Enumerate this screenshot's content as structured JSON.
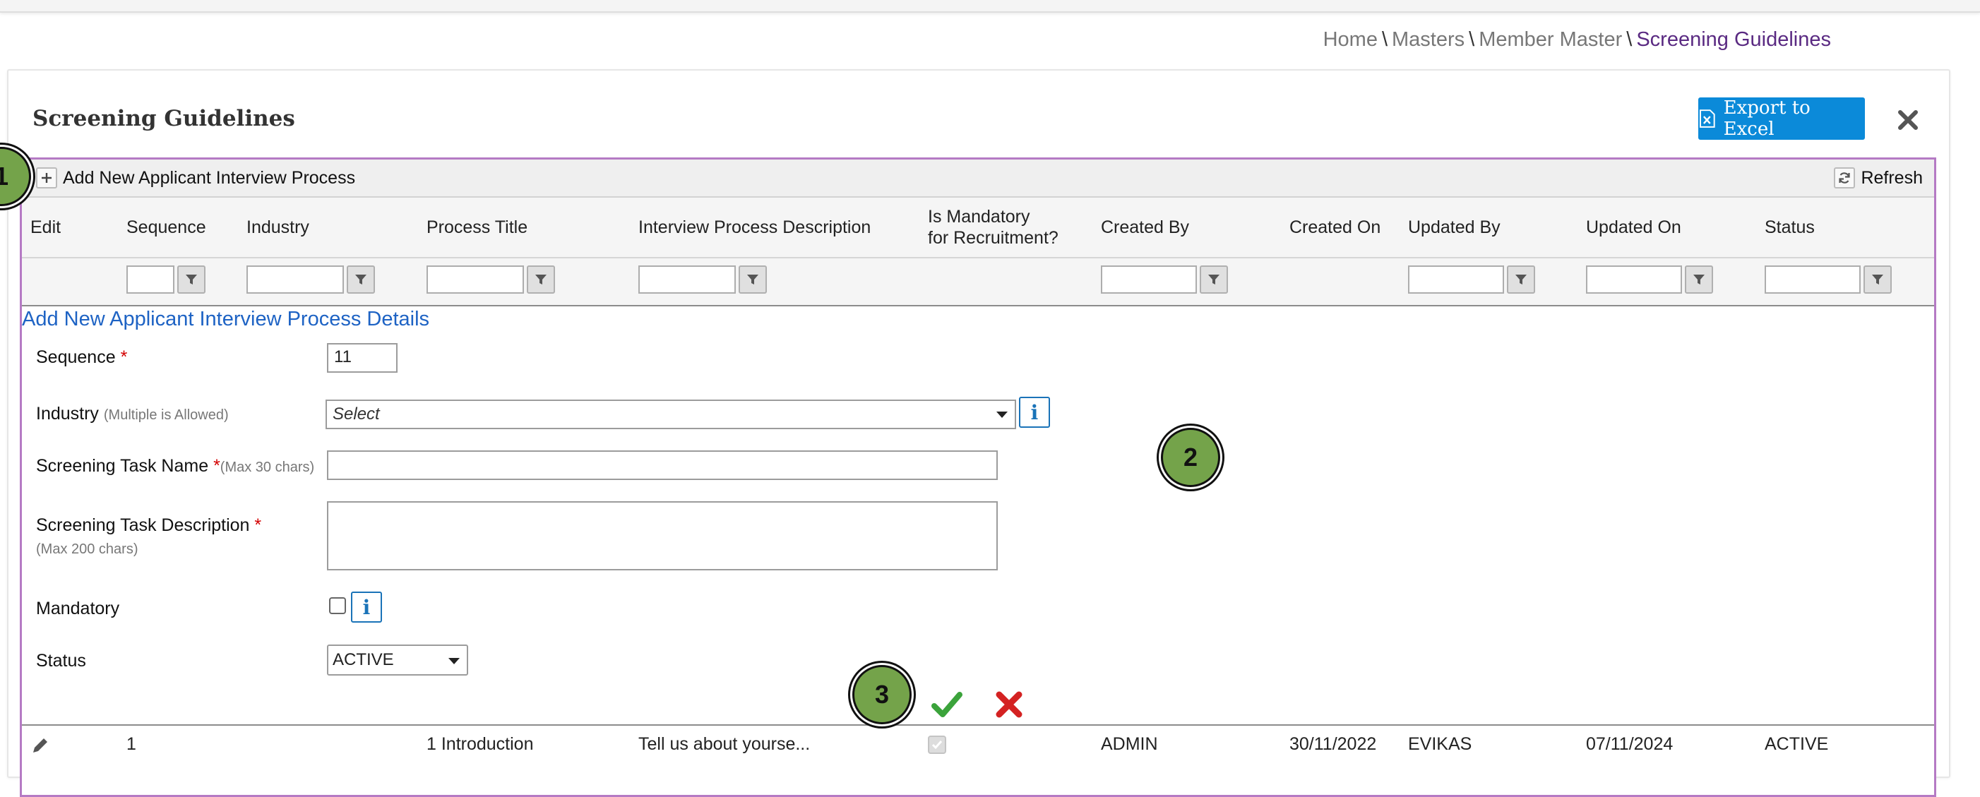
{
  "breadcrumb": {
    "home": "Home",
    "masters": "Masters",
    "member_master": "Member Master",
    "current": "Screening Guidelines",
    "separator": "\\"
  },
  "page": {
    "title": "Screening Guidelines",
    "export_label": "Export to Excel"
  },
  "toolbar": {
    "add_label": "Add New Applicant Interview Process",
    "refresh_label": "Refresh"
  },
  "columns": {
    "edit": "Edit",
    "sequence": "Sequence",
    "industry": "Industry",
    "process_title": "Process Title",
    "description": "Interview Process Description",
    "mandatory_line1": "Is Mandatory",
    "mandatory_line2": "for Recruitment?",
    "created_by": "Created By",
    "created_on": "Created On",
    "updated_by": "Updated By",
    "updated_on": "Updated On",
    "status": "Status"
  },
  "form": {
    "title": "Add New Applicant Interview Process Details",
    "sequence_label": "Sequence",
    "sequence_value": "11",
    "industry_label": "Industry",
    "industry_hint": "(Multiple is Allowed)",
    "industry_placeholder": "Select",
    "task_name_label": "Screening Task Name",
    "task_name_hint": "(Max 30 chars)",
    "task_desc_label": "Screening Task Description",
    "task_desc_hint": "(Max 200 chars)",
    "mandatory_label": "Mandatory",
    "status_label": "Status",
    "status_value": "ACTIVE",
    "required_mark": "*"
  },
  "markers": [
    "1",
    "2",
    "3"
  ],
  "rows": [
    {
      "sequence": "1",
      "industry": "",
      "process_title": "1 Introduction",
      "description": "Tell us about yourse...",
      "created_by": "ADMIN",
      "created_on": "30/11/2022",
      "updated_by": "EVIKAS",
      "updated_on": "07/11/2024",
      "status": "ACTIVE"
    }
  ],
  "icons": {
    "export": "excel-file-icon",
    "close": "close-icon",
    "add": "plus-icon",
    "refresh": "refresh-icon",
    "filter": "filter-funnel-icon",
    "info": "info-icon",
    "save": "checkmark-icon",
    "cancel": "x-mark-icon",
    "edit": "pencil-icon"
  },
  "colors": {
    "accent": "#0b8ad9",
    "breadcrumb_current": "#5a2a82",
    "form_title": "#1e63c4",
    "grid_border": "#b57ac4",
    "marker": "#74a34a",
    "save": "#3ba33b",
    "cancel": "#d42222"
  }
}
